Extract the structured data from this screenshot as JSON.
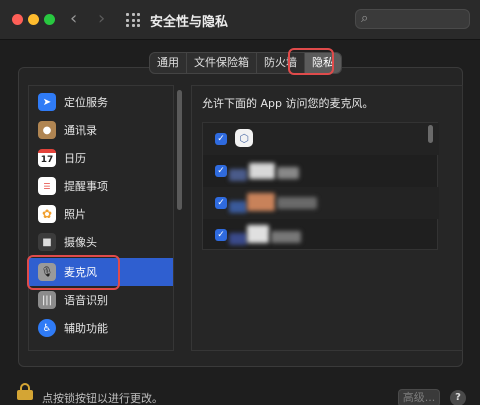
{
  "window": {
    "title": "安全性与隐私",
    "search_icon": "search-icon"
  },
  "tabs": [
    {
      "label": "通用",
      "selected": false
    },
    {
      "label": "文件保险箱",
      "selected": false
    },
    {
      "label": "防火墙",
      "selected": false
    },
    {
      "label": "隐私",
      "selected": true
    }
  ],
  "sidebar": {
    "items": [
      {
        "label": "定位服务",
        "icon": "location-arrow-icon",
        "color": "#2f7bf6",
        "selected": false
      },
      {
        "label": "通讯录",
        "icon": "contacts-icon",
        "color": "#b08552",
        "selected": false
      },
      {
        "label": "日历",
        "icon": "calendar-icon",
        "color": "#ffffff",
        "selected": false
      },
      {
        "label": "提醒事项",
        "icon": "reminders-icon",
        "color": "#ffffff",
        "selected": false
      },
      {
        "label": "照片",
        "icon": "photos-icon",
        "color": "#ffffff",
        "selected": false
      },
      {
        "label": "摄像头",
        "icon": "camera-icon",
        "color": "#3c3c3c",
        "selected": false
      },
      {
        "label": "麦克风",
        "icon": "microphone-icon",
        "color": "#9a9a9a",
        "selected": true
      },
      {
        "label": "语音识别",
        "icon": "speech-recognition-icon",
        "color": "#8c8c8c",
        "selected": false
      },
      {
        "label": "辅助功能",
        "icon": "accessibility-icon",
        "color": "#2f7bf6",
        "selected": false
      }
    ],
    "calendar_day": "17"
  },
  "main": {
    "heading": "允许下面的 App 访问您的麦克风。",
    "apps": [
      {
        "checked": true
      },
      {
        "checked": true
      },
      {
        "checked": true
      },
      {
        "checked": true
      }
    ]
  },
  "footer": {
    "lock_text": "点按锁按钮以进行更改。",
    "advanced_label": "高级...",
    "help_label": "?"
  },
  "colors": {
    "accent": "#2f5fd0",
    "highlight": "#e04b4b",
    "checkbox": "#2f6bdf"
  }
}
